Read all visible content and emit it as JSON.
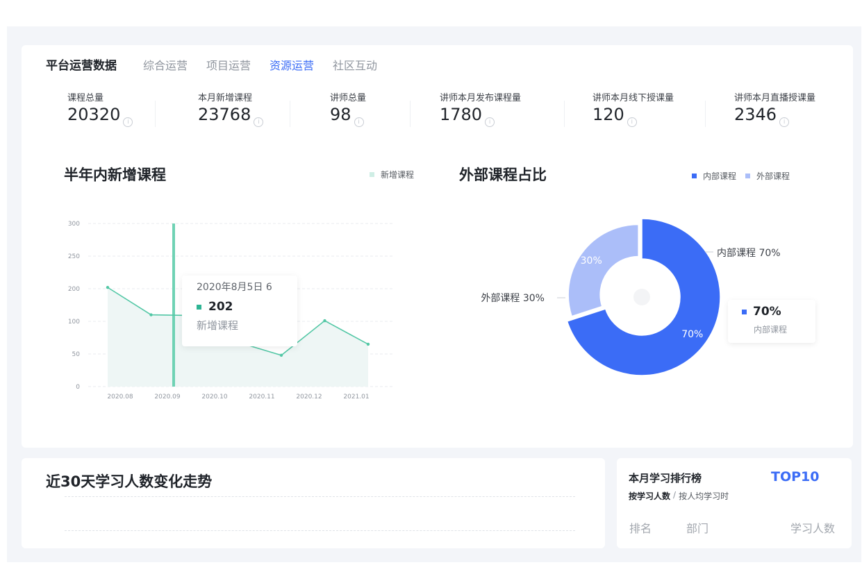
{
  "header": {
    "title": "平台运营数据",
    "tabs": [
      "综合运营",
      "项目运营",
      "资源运营",
      "社区互动"
    ],
    "active_tab": "资源运营"
  },
  "stats": [
    {
      "label": "课程总量",
      "value": "20320"
    },
    {
      "label": "本月新增课程",
      "value": "23768"
    },
    {
      "label": "讲师总量",
      "value": "98"
    },
    {
      "label": "讲师本月发布课程量",
      "value": "1780"
    },
    {
      "label": "讲师本月线下授课量",
      "value": "120"
    },
    {
      "label": "讲师本月直播授课量",
      "value": "2346"
    }
  ],
  "info_icon": "i",
  "line_section": {
    "title": "半年内新增课程",
    "legend": "新增课程",
    "tooltip": {
      "date": "2020年8月5日 6",
      "value": "202",
      "series": "新增课程"
    }
  },
  "pie_section": {
    "title": "外部课程占比",
    "legend": [
      "内部课程",
      "外部课程"
    ],
    "tooltip": {
      "value": "70%",
      "name": "内部课程"
    }
  },
  "chart_data": [
    {
      "type": "area",
      "series": [
        {
          "name": "新增课程",
          "color": "#52c7a5",
          "values": [
            202,
            120,
            118,
            68,
            48,
            102,
            65
          ]
        }
      ],
      "x_ticks": [
        "2020.08",
        "2020.09",
        "2020.10",
        "2020.11",
        "2020.12",
        "2021.01"
      ],
      "y_ticks": [
        "300",
        "250",
        "200",
        "100",
        "50",
        "0"
      ],
      "grid": true
    },
    {
      "type": "pie",
      "donut": true,
      "slices": [
        {
          "name": "内部课程",
          "value": 70,
          "label": "70%",
          "outer_label": "内部课程 70%",
          "color": "#3b6cf6"
        },
        {
          "name": "外部课程",
          "value": 30,
          "label": "30%",
          "outer_label": "外部课程 30%",
          "color": "#abbef9"
        }
      ]
    }
  ],
  "trend": {
    "title": "近30天学习人数变化走势"
  },
  "ranking": {
    "title": "本月学习排行榜",
    "top": "TOP10",
    "sort_active": "按学习人数",
    "sort_sep": "/",
    "sort_other": "按人均学习时",
    "columns": [
      "排名",
      "部门",
      "学习人数"
    ]
  }
}
